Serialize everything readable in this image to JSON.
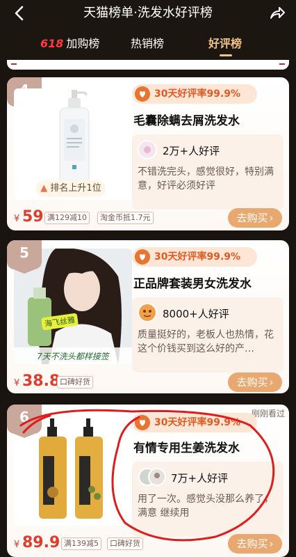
{
  "header": {
    "title": "天猫榜单·洗发水好评榜",
    "back_icon": "back-arrow-icon",
    "share_icon": "share-arrow-icon"
  },
  "tabs": [
    {
      "prefix": "618",
      "label": "加购榜",
      "active": false
    },
    {
      "label": "热销榜",
      "active": false
    },
    {
      "label": "好评榜",
      "active": true
    }
  ],
  "colors": {
    "accent": "#f1c389",
    "price": "#e03c2d",
    "buy_button": "#e9a86f",
    "badge_text": "#e05a22"
  },
  "products": [
    {
      "rank": "4",
      "badge": "30天好评率99.9%",
      "name": "毛囊除螨去屑洗发水",
      "review_count": "2万+人好评",
      "review": "不错洗完头，感觉很好，特别满意，好评必须好评",
      "rank_change": "排名上升1位",
      "currency": "¥",
      "price": "59",
      "tags": [
        "满129减10",
        "淘金币抵1.7元"
      ],
      "buy_label": "去购买"
    },
    {
      "rank": "5",
      "badge": "30天好评率99.9%",
      "name": "正品牌套装男女洗发水",
      "review_count": "8000+人好评",
      "review": "质量挺好的，老板人也热情，花这个价钱买到这么好的产…",
      "image_caption": "7天不洗头都样接签",
      "image_sticker": "海飞丝雅",
      "currency": "¥",
      "price": "38.8",
      "tags": [
        "口碑好货"
      ],
      "buy_label": "去购买"
    },
    {
      "rank": "6",
      "recent_label": "刚刚看过",
      "badge": "30天好评率99.9%",
      "name": "有情专用生姜洗发水",
      "review_count": "7万+人好评",
      "review": "用了一次。感觉头没那么养了，满意 继续用",
      "currency": "¥",
      "price": "89.9",
      "tags": [
        "满139减5",
        "口碑好货"
      ],
      "buy_label": "去购买"
    }
  ]
}
